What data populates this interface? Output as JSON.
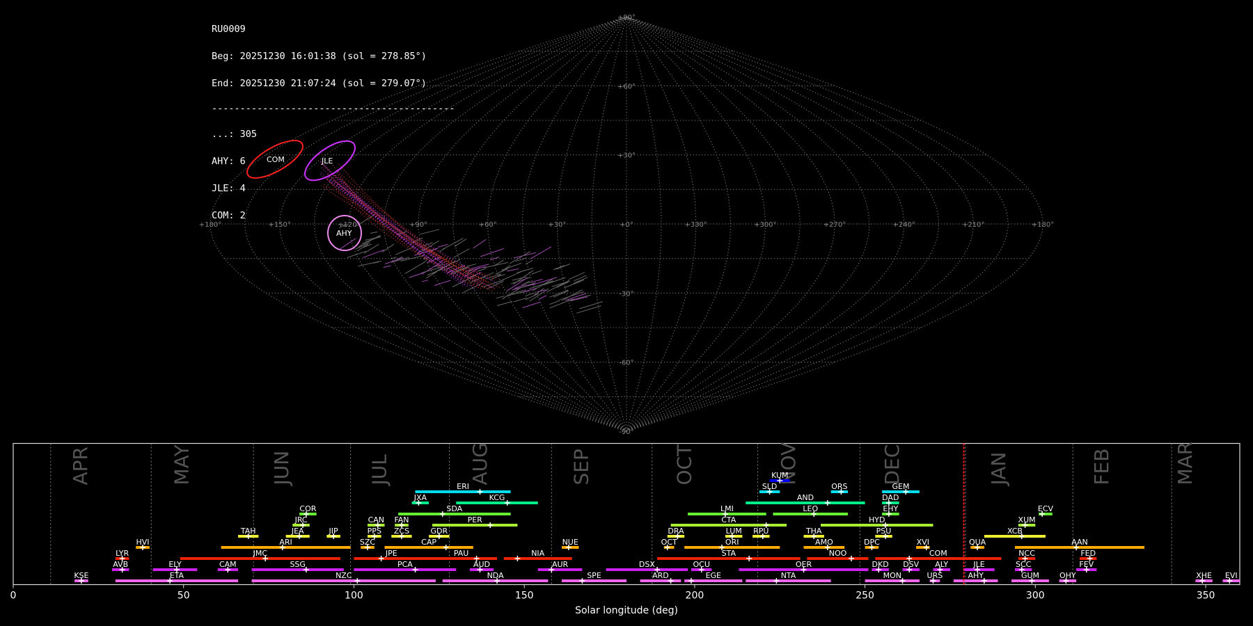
{
  "info": {
    "station": "RU0009",
    "beg": "Beg: 20251230 16:01:38 (sol = 278.85°)",
    "end": "End: 20251230 21:07:24 (sol = 279.07°)",
    "separator": "-------------------------------------------",
    "counts": [
      "...: 305",
      "AHY: 6",
      "JLE: 4",
      "COM: 2"
    ]
  },
  "sky_map": {
    "projection": "sinusoidal",
    "lon_labels": [
      "+180°",
      "+150°",
      "+120°",
      "+90°",
      "+60°",
      "+30°",
      "+0°",
      "+330°",
      "+300°",
      "+270°",
      "+240°",
      "+210°",
      "+180°"
    ],
    "lat_labels": [
      "+90°",
      "+60°",
      "+30°",
      "-30°",
      "-60°",
      "-90°"
    ],
    "radiants": [
      {
        "name": "COM",
        "color": "#ff2020"
      },
      {
        "name": "JLE",
        "color": "#cc33ff"
      },
      {
        "name": "AHY",
        "color": "#ee88ee"
      }
    ]
  },
  "chart_data": {
    "type": "bar",
    "xlabel": "Solar longitude (deg)",
    "xlim": [
      0,
      360
    ],
    "xticks": [
      0,
      50,
      100,
      150,
      200,
      250,
      300,
      350
    ],
    "current_sol": 279,
    "months": [
      {
        "name": "APR",
        "start": 11
      },
      {
        "name": "MAY",
        "start": 40.5
      },
      {
        "name": "JUN",
        "start": 70.5
      },
      {
        "name": "JUL",
        "start": 99
      },
      {
        "name": "AUG",
        "start": 128
      },
      {
        "name": "SEP",
        "start": 158
      },
      {
        "name": "OCT",
        "start": 187.5
      },
      {
        "name": "NOV",
        "start": 218.5
      },
      {
        "name": "DEC",
        "start": 248.5
      },
      {
        "name": "JAN",
        "start": 279.5
      },
      {
        "name": "FEB",
        "start": 311
      },
      {
        "name": "MAR",
        "start": 340
      }
    ],
    "showers": [
      {
        "code": "KUM",
        "start": 222,
        "end": 228,
        "peak": 225,
        "row": 10,
        "color": "#0000ee"
      },
      {
        "code": "ERI",
        "start": 118,
        "end": 146,
        "peak": 137,
        "row": 9,
        "color": "#00ddee"
      },
      {
        "code": "SLD",
        "start": 219,
        "end": 225,
        "peak": 222,
        "row": 9,
        "color": "#00ddee"
      },
      {
        "code": "ORS",
        "start": 240,
        "end": 245,
        "peak": 243,
        "row": 9,
        "color": "#00ddee"
      },
      {
        "code": "GEM",
        "start": 255,
        "end": 266,
        "peak": 262,
        "row": 9,
        "color": "#00ddee"
      },
      {
        "code": "JXA",
        "start": 117,
        "end": 122,
        "peak": 119,
        "row": 8,
        "color": "#00ee88"
      },
      {
        "code": "KCG",
        "start": 130,
        "end": 154,
        "peak": 145,
        "row": 8,
        "color": "#00ee88"
      },
      {
        "code": "AND",
        "start": 215,
        "end": 250,
        "peak": 239,
        "row": 8,
        "color": "#00ee88"
      },
      {
        "code": "DAD",
        "start": 255,
        "end": 260,
        "peak": 257,
        "row": 8,
        "color": "#00ee88"
      },
      {
        "code": "COR",
        "start": 84,
        "end": 89,
        "peak": 86,
        "row": 7,
        "color": "#66ee33"
      },
      {
        "code": "SDA",
        "start": 113,
        "end": 146,
        "peak": 126,
        "row": 7,
        "color": "#66ee33"
      },
      {
        "code": "LMI",
        "start": 198,
        "end": 221,
        "peak": 209,
        "row": 7,
        "color": "#66ee33"
      },
      {
        "code": "LEO",
        "start": 223,
        "end": 245,
        "peak": 235,
        "row": 7,
        "color": "#66ee33"
      },
      {
        "code": "EHY",
        "start": 255,
        "end": 260,
        "peak": 257,
        "row": 7,
        "color": "#66ee33"
      },
      {
        "code": "ECV",
        "start": 301,
        "end": 305,
        "peak": 302,
        "row": 7,
        "color": "#66ee33"
      },
      {
        "code": "JRC",
        "start": 82,
        "end": 87,
        "peak": 85,
        "row": 6,
        "color": "#aaee33"
      },
      {
        "code": "CAN",
        "start": 104,
        "end": 109,
        "peak": 107,
        "row": 6,
        "color": "#aaee33"
      },
      {
        "code": "FAN",
        "start": 112,
        "end": 116,
        "peak": 114,
        "row": 6,
        "color": "#aaee33"
      },
      {
        "code": "PER",
        "start": 123,
        "end": 148,
        "peak": 140,
        "row": 6,
        "color": "#aaee33"
      },
      {
        "code": "CTA",
        "start": 193,
        "end": 227,
        "peak": 221,
        "row": 6,
        "color": "#aaee33"
      },
      {
        "code": "HYD",
        "start": 237,
        "end": 270,
        "peak": 256,
        "row": 6,
        "color": "#aaee33"
      },
      {
        "code": "XUM",
        "start": 295,
        "end": 300,
        "peak": 297,
        "row": 6,
        "color": "#aaee33"
      },
      {
        "code": "TAH",
        "start": 66,
        "end": 72,
        "peak": 69,
        "row": 5,
        "color": "#eeee33"
      },
      {
        "code": "JEA",
        "start": 80,
        "end": 87,
        "peak": 84,
        "row": 5,
        "color": "#eeee33"
      },
      {
        "code": "JIP",
        "start": 92,
        "end": 96,
        "peak": 94,
        "row": 5,
        "color": "#eeee33"
      },
      {
        "code": "PPS",
        "start": 104,
        "end": 108,
        "peak": 106,
        "row": 5,
        "color": "#eeee33"
      },
      {
        "code": "ZCS",
        "start": 111,
        "end": 117,
        "peak": 114,
        "row": 5,
        "color": "#eeee33"
      },
      {
        "code": "GDR",
        "start": 122,
        "end": 128,
        "peak": 125,
        "row": 5,
        "color": "#eeee33"
      },
      {
        "code": "DRA",
        "start": 192,
        "end": 197,
        "peak": 195,
        "row": 5,
        "color": "#eeee33"
      },
      {
        "code": "LUM",
        "start": 209,
        "end": 214,
        "peak": 211,
        "row": 5,
        "color": "#eeee33"
      },
      {
        "code": "RPU",
        "start": 217,
        "end": 222,
        "peak": 220,
        "row": 5,
        "color": "#eeee33"
      },
      {
        "code": "THA",
        "start": 232,
        "end": 238,
        "peak": 235,
        "row": 5,
        "color": "#eeee33"
      },
      {
        "code": "PSU",
        "start": 253,
        "end": 258,
        "peak": 256,
        "row": 5,
        "color": "#eeee33"
      },
      {
        "code": "XCB",
        "start": 285,
        "end": 303,
        "peak": 296,
        "row": 5,
        "color": "#eeee33"
      },
      {
        "code": "HVI",
        "start": 36,
        "end": 40,
        "peak": 38,
        "row": 4,
        "color": "#ffaa00"
      },
      {
        "code": "ARI",
        "start": 61,
        "end": 99,
        "peak": 79,
        "row": 4,
        "color": "#ffaa00"
      },
      {
        "code": "SZC",
        "start": 102,
        "end": 106,
        "peak": 104,
        "row": 4,
        "color": "#ffaa00"
      },
      {
        "code": "CAP",
        "start": 109,
        "end": 135,
        "peak": 127,
        "row": 4,
        "color": "#ffaa00"
      },
      {
        "code": "NUE",
        "start": 161,
        "end": 166,
        "peak": 163,
        "row": 4,
        "color": "#ffaa00"
      },
      {
        "code": "OCT",
        "start": 191,
        "end": 194,
        "peak": 192,
        "row": 4,
        "color": "#ffaa00"
      },
      {
        "code": "ORI",
        "start": 197,
        "end": 225,
        "peak": 208,
        "row": 4,
        "color": "#ffaa00"
      },
      {
        "code": "AMO",
        "start": 232,
        "end": 244,
        "peak": 239,
        "row": 4,
        "color": "#ffaa00"
      },
      {
        "code": "DPC",
        "start": 250,
        "end": 254,
        "peak": 252,
        "row": 4,
        "color": "#ffaa00"
      },
      {
        "code": "XVI",
        "start": 265,
        "end": 269,
        "peak": 268,
        "row": 4,
        "color": "#ffaa00"
      },
      {
        "code": "QUA",
        "start": 281,
        "end": 285,
        "peak": 283,
        "row": 4,
        "color": "#ffaa00"
      },
      {
        "code": "AAN",
        "start": 294,
        "end": 332,
        "peak": 312,
        "row": 4,
        "color": "#ffaa00"
      },
      {
        "code": "LYR",
        "start": 30,
        "end": 34,
        "peak": 32,
        "row": 3,
        "color": "#ee2200"
      },
      {
        "code": "JMC",
        "start": 49,
        "end": 96,
        "peak": 74,
        "row": 3,
        "color": "#ee2200"
      },
      {
        "code": "JPE",
        "start": 100,
        "end": 122,
        "peak": 108,
        "row": 3,
        "color": "#ee2200"
      },
      {
        "code": "PAU",
        "start": 121,
        "end": 142,
        "peak": 136,
        "row": 3,
        "color": "#ee2200"
      },
      {
        "code": "NIA",
        "start": 144,
        "end": 164,
        "peak": 148,
        "row": 3,
        "color": "#ee2200"
      },
      {
        "code": "STA",
        "start": 189,
        "end": 231,
        "peak": 216,
        "row": 3,
        "color": "#ee2200"
      },
      {
        "code": "NOO",
        "start": 233,
        "end": 251,
        "peak": 246,
        "row": 3,
        "color": "#ee2200"
      },
      {
        "code": "COM",
        "start": 253,
        "end": 290,
        "peak": 263,
        "row": 3,
        "color": "#ee2200"
      },
      {
        "code": "NCC",
        "start": 295,
        "end": 300,
        "peak": 297,
        "row": 3,
        "color": "#ee2200"
      },
      {
        "code": "FED",
        "start": 313,
        "end": 318,
        "peak": 316,
        "row": 3,
        "color": "#ee2200"
      },
      {
        "code": "AVB",
        "start": 29,
        "end": 34,
        "peak": 32,
        "row": 2,
        "color": "#cc22ee"
      },
      {
        "code": "ELY",
        "start": 41,
        "end": 54,
        "peak": 48,
        "row": 2,
        "color": "#cc22ee"
      },
      {
        "code": "CAM",
        "start": 60,
        "end": 66,
        "peak": 63,
        "row": 2,
        "color": "#cc22ee"
      },
      {
        "code": "SSG",
        "start": 70,
        "end": 97,
        "peak": 86,
        "row": 2,
        "color": "#cc22ee"
      },
      {
        "code": "PCA",
        "start": 100,
        "end": 130,
        "peak": 118,
        "row": 2,
        "color": "#cc22ee"
      },
      {
        "code": "AUD",
        "start": 134,
        "end": 141,
        "peak": 137,
        "row": 2,
        "color": "#cc22ee"
      },
      {
        "code": "AUR",
        "start": 154,
        "end": 167,
        "peak": 158,
        "row": 2,
        "color": "#cc22ee"
      },
      {
        "code": "DSX",
        "start": 174,
        "end": 198,
        "peak": 189,
        "row": 2,
        "color": "#cc22ee"
      },
      {
        "code": "OCU",
        "start": 199,
        "end": 205,
        "peak": 202,
        "row": 2,
        "color": "#cc22ee"
      },
      {
        "code": "OER",
        "start": 213,
        "end": 251,
        "peak": 232,
        "row": 2,
        "color": "#cc22ee"
      },
      {
        "code": "DKD",
        "start": 252,
        "end": 257,
        "peak": 254,
        "row": 2,
        "color": "#cc22ee"
      },
      {
        "code": "DSV",
        "start": 261,
        "end": 266,
        "peak": 263,
        "row": 2,
        "color": "#cc22ee"
      },
      {
        "code": "ALY",
        "start": 270,
        "end": 275,
        "peak": 272,
        "row": 2,
        "color": "#cc22ee"
      },
      {
        "code": "JLE",
        "start": 279,
        "end": 288,
        "peak": 283,
        "row": 2,
        "color": "#cc22ee"
      },
      {
        "code": "SCC",
        "start": 294,
        "end": 299,
        "peak": 296,
        "row": 2,
        "color": "#cc22ee"
      },
      {
        "code": "FEV",
        "start": 312,
        "end": 318,
        "peak": 315,
        "row": 2,
        "color": "#cc22ee"
      },
      {
        "code": "KSE",
        "start": 18,
        "end": 22,
        "peak": 20,
        "row": 1,
        "color": "#ee66ee"
      },
      {
        "code": "ETA",
        "start": 30,
        "end": 66,
        "peak": 46,
        "row": 1,
        "color": "#ee66ee"
      },
      {
        "code": "NZC",
        "start": 70,
        "end": 124,
        "peak": 101,
        "row": 1,
        "color": "#ee66ee"
      },
      {
        "code": "NDA",
        "start": 126,
        "end": 157,
        "peak": 142,
        "row": 1,
        "color": "#ee66ee"
      },
      {
        "code": "SPE",
        "start": 161,
        "end": 180,
        "peak": 167,
        "row": 1,
        "color": "#ee66ee"
      },
      {
        "code": "ARD",
        "start": 184,
        "end": 196,
        "peak": 193,
        "row": 1,
        "color": "#ee66ee"
      },
      {
        "code": "EGE",
        "start": 197,
        "end": 214,
        "peak": 199,
        "row": 1,
        "color": "#ee66ee"
      },
      {
        "code": "NTA",
        "start": 215,
        "end": 240,
        "peak": 224,
        "row": 1,
        "color": "#ee66ee"
      },
      {
        "code": "MON",
        "start": 250,
        "end": 266,
        "peak": 261,
        "row": 1,
        "color": "#ee66ee"
      },
      {
        "code": "URS",
        "start": 269,
        "end": 272,
        "peak": 270,
        "row": 1,
        "color": "#ee66ee"
      },
      {
        "code": "AHY",
        "start": 276,
        "end": 289,
        "peak": 285,
        "row": 1,
        "color": "#ee66ee"
      },
      {
        "code": "GUM",
        "start": 293,
        "end": 304,
        "peak": 299,
        "row": 1,
        "color": "#ee66ee"
      },
      {
        "code": "OHY",
        "start": 307,
        "end": 312,
        "peak": 309,
        "row": 1,
        "color": "#ee66ee"
      },
      {
        "code": "XHE",
        "start": 347,
        "end": 352,
        "peak": 349,
        "row": 1,
        "color": "#ee66ee"
      },
      {
        "code": "EVI",
        "start": 355,
        "end": 360,
        "peak": 357,
        "row": 1,
        "color": "#ee66ee"
      }
    ]
  }
}
